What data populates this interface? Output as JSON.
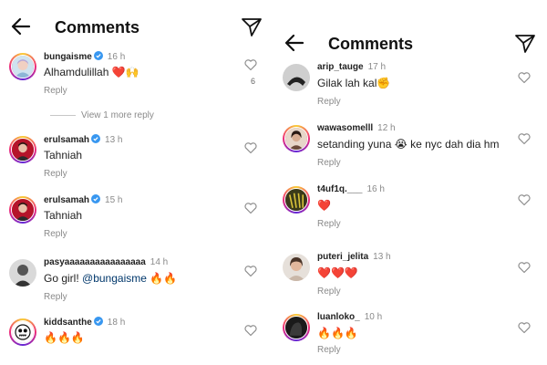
{
  "left": {
    "header": {
      "title": "Comments"
    },
    "view_more": "View 1 more reply",
    "comments": [
      {
        "username": "bungaisme",
        "verified": true,
        "time": "16 h",
        "text": "Alhamdulillah ❤️🙌",
        "reply": "Reply",
        "likes": "6"
      },
      {
        "username": "erulsamah",
        "verified": true,
        "time": "13 h",
        "text": "Tahniah",
        "reply": "Reply"
      },
      {
        "username": "erulsamah",
        "verified": true,
        "time": "15 h",
        "text": "Tahniah",
        "reply": "Reply"
      },
      {
        "username": "pasyaaaaaaaaaaaaaaaa",
        "verified": false,
        "time": "14 h",
        "text_pre": "Go girl! ",
        "mention": "@bungaisme",
        "text_post": " 🔥🔥",
        "reply": "Reply"
      },
      {
        "username": "kiddsanthe",
        "verified": true,
        "time": "18 h",
        "text": "🔥🔥🔥",
        "reply": "Reply"
      }
    ]
  },
  "right": {
    "header": {
      "title": "Comments"
    },
    "comments": [
      {
        "username": "arip_tauge",
        "time": "17 h",
        "text": "Gilak lah kal✊",
        "reply": "Reply"
      },
      {
        "username": "wawasomelll",
        "time": "12 h",
        "text": "setanding yuna 😭 ke nyc dah dia hm",
        "reply": "Reply"
      },
      {
        "username": "t4uf1q.___",
        "time": "16 h",
        "text": "❤️",
        "reply": "Reply"
      },
      {
        "username": "puteri_jelita",
        "time": "13 h",
        "text": "❤️❤️❤️",
        "reply": "Reply"
      },
      {
        "username": "luanloko_",
        "time": "10 h",
        "text": "🔥🔥🔥",
        "reply": "Reply"
      }
    ]
  },
  "watermark": {
    "text": "murai"
  },
  "colors": {
    "verified": "#3897f0",
    "heart": "#e0245e",
    "watermark": "#f3c6dd"
  },
  "icons": {
    "back": "arrow-left-icon",
    "send": "paper-plane-icon",
    "like": "heart-outline-icon",
    "verified": "verified-badge-icon"
  }
}
